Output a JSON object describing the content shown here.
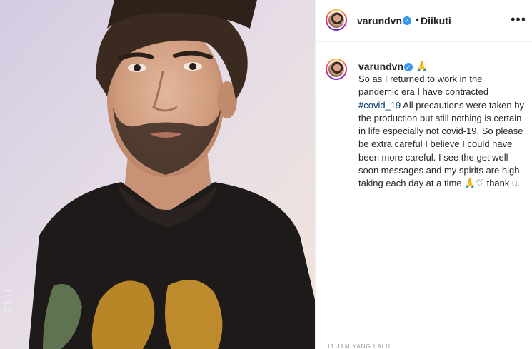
{
  "header": {
    "username": "varundvn",
    "verified_mark": "✓",
    "separator": "•",
    "follow_label": "Diikuti",
    "more_label": "•••"
  },
  "caption": {
    "username": "varundvn",
    "verified_mark": "✓",
    "emoji_after_name": "🙏",
    "text_before_tag": "So as I returned to work in the pandemic era I have contracted ",
    "hashtag": "#covid_19",
    "text_after_tag": " All precautions were taken by the production but still nothing is certain in life especially not covid-19. So please be extra careful I believe I could have been more careful. I see the get well soon messages and my spirits are high taking each day at a time 🙏♡ thank u."
  },
  "media": {
    "description_icon": "selfie-photo",
    "watermark": "21 L"
  },
  "footer": {
    "cut_text": "11 JAM YANG LALU"
  },
  "colors": {
    "verified": "#3897f0",
    "hashtag": "#00376b",
    "text": "#262626"
  }
}
